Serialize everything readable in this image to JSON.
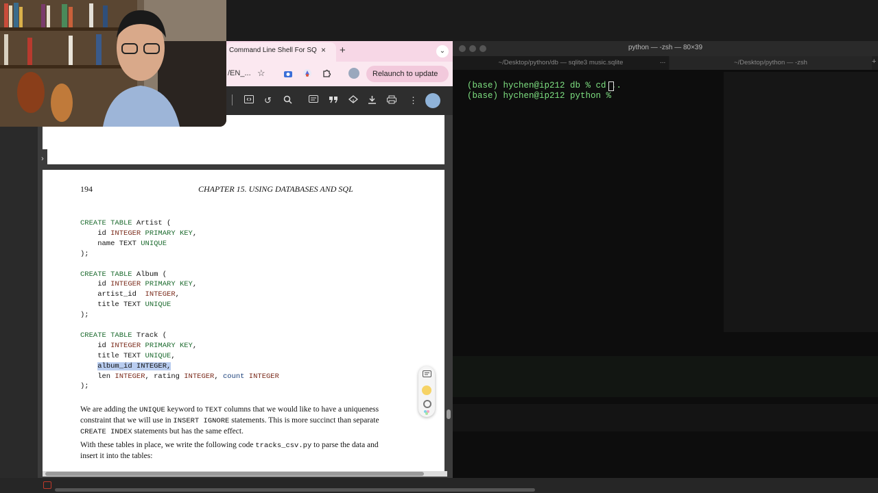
{
  "browser": {
    "tab_title": "Command Line Shell For SQL",
    "tab_close": "×",
    "new_tab": "+",
    "tab_menu": "⌄",
    "url_text": "/EN_...",
    "relaunch_label": "Relaunch to update",
    "relaunch_more": "⋮",
    "toolbar_more": "⋮"
  },
  "pdf": {
    "page_number": "194",
    "chapter_heading": "CHAPTER 15.  USING DATABASES AND SQL",
    "paragraph_1": [
      {
        "t": "We are adding the "
      },
      {
        "m": "UNIQUE"
      },
      {
        "t": " keyword to "
      },
      {
        "m": "TEXT"
      },
      {
        "t": " columns that we would like to have a uniqueness constraint that we will use in "
      },
      {
        "m": "INSERT IGNORE"
      },
      {
        "t": " statements. This is more succinct than separate "
      },
      {
        "m": "CREATE INDEX"
      },
      {
        "t": " statements but has the same effect."
      }
    ],
    "paragraph_2": [
      {
        "t": "With these tables in place, we write the following code "
      },
      {
        "m": "tracks_csv.py"
      },
      {
        "t": " to parse the data and insert it into the tables:"
      }
    ]
  },
  "sql": [
    [
      {
        "k": "CREATE TABLE"
      },
      {
        "p": " Artist ("
      }
    ],
    [
      {
        "p": "    id "
      },
      {
        "y": "INTEGER"
      },
      {
        "p": " "
      },
      {
        "k": "PRIMARY KEY"
      },
      {
        "p": ","
      }
    ],
    [
      {
        "p": "    name TEXT "
      },
      {
        "k": "UNIQUE"
      }
    ],
    [
      {
        "p": ");"
      }
    ],
    [],
    [
      {
        "k": "CREATE TABLE"
      },
      {
        "p": " Album ("
      }
    ],
    [
      {
        "p": "    id "
      },
      {
        "y": "INTEGER"
      },
      {
        "p": " "
      },
      {
        "k": "PRIMARY KEY"
      },
      {
        "p": ","
      }
    ],
    [
      {
        "p": "    artist_id  "
      },
      {
        "y": "INTEGER"
      },
      {
        "p": ","
      }
    ],
    [
      {
        "p": "    title TEXT "
      },
      {
        "k": "UNIQUE"
      }
    ],
    [
      {
        "p": ");"
      }
    ],
    [],
    [
      {
        "k": "CREATE TABLE"
      },
      {
        "p": " Track ("
      }
    ],
    [
      {
        "p": "    id "
      },
      {
        "y": "INTEGER"
      },
      {
        "p": " "
      },
      {
        "k": "PRIMARY KEY"
      },
      {
        "p": ","
      }
    ],
    [
      {
        "p": "    title TEXT "
      },
      {
        "k": "UNIQUE"
      },
      {
        "p": ","
      }
    ],
    [
      {
        "p": "    "
      },
      {
        "h": "album_id INTEGER,"
      }
    ],
    [
      {
        "p": "    len "
      },
      {
        "y": "INTEGER"
      },
      {
        "p": ", rating "
      },
      {
        "y": "INTEGER"
      },
      {
        "p": ", "
      },
      {
        "c": "count"
      },
      {
        "p": " "
      },
      {
        "y": "INTEGER"
      }
    ],
    [
      {
        "p": ");"
      }
    ]
  ],
  "terminal": {
    "window_title": "python — -zsh — 80×39",
    "tab1": "~/Desktop/python/db — sqlite3 music.sqlite",
    "tab1_more": "...",
    "tab2": "~/Desktop/python — -zsh",
    "new_tab": "+",
    "lines": [
      {
        "text": "(base) hychen@ip212 db % cd .."
      },
      {
        "text": "(base) hychen@ip212 python % "
      }
    ]
  },
  "colors": {
    "keyword": "#1d6b2f",
    "type": "#7a2a1a",
    "selection": "#b9cdf0",
    "tab_bar": "#f7d7e6"
  },
  "icons": [
    "star-icon",
    "extension-icon",
    "reload-icon",
    "search-icon",
    "comment-icon",
    "quote-icon",
    "download-icon",
    "print-icon",
    "more-icon",
    "chat-icon"
  ]
}
